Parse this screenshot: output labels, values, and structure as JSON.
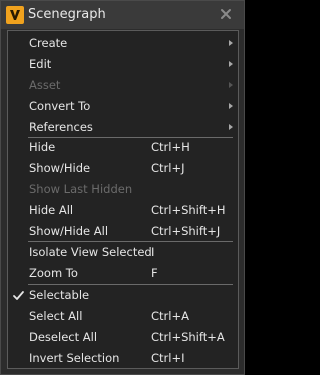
{
  "window": {
    "title": "Scenegraph",
    "icon": "app-logo-icon",
    "close_icon": "close-icon",
    "accent_color": "#f0a21e"
  },
  "menu": {
    "items": [
      {
        "label": "Create",
        "submenu": true,
        "enabled": true
      },
      {
        "label": "Edit",
        "submenu": true,
        "enabled": true
      },
      {
        "label": "Asset",
        "submenu": true,
        "enabled": false
      },
      {
        "label": "Convert To",
        "submenu": true,
        "enabled": true
      },
      {
        "label": "References",
        "submenu": true,
        "enabled": true
      },
      {
        "label": "Hide",
        "shortcut": "Ctrl+H",
        "enabled": true
      },
      {
        "label": "Show/Hide",
        "shortcut": "Ctrl+J",
        "enabled": true
      },
      {
        "label": "Show Last Hidden",
        "enabled": false
      },
      {
        "label": "Hide All",
        "shortcut": "Ctrl+Shift+H",
        "enabled": true
      },
      {
        "label": "Show/Hide All",
        "shortcut": "Ctrl+Shift+J",
        "enabled": true
      },
      {
        "label": "Isolate View Selected",
        "shortcut": "I",
        "enabled": true
      },
      {
        "label": "Zoom To",
        "shortcut": "F",
        "enabled": true
      },
      {
        "label": "Selectable",
        "checked": true,
        "enabled": true
      },
      {
        "label": "Select All",
        "shortcut": "Ctrl+A",
        "enabled": true
      },
      {
        "label": "Deselect All",
        "shortcut": "Ctrl+Shift+A",
        "enabled": true
      },
      {
        "label": "Invert Selection",
        "shortcut": "Ctrl+I",
        "enabled": true
      }
    ]
  }
}
